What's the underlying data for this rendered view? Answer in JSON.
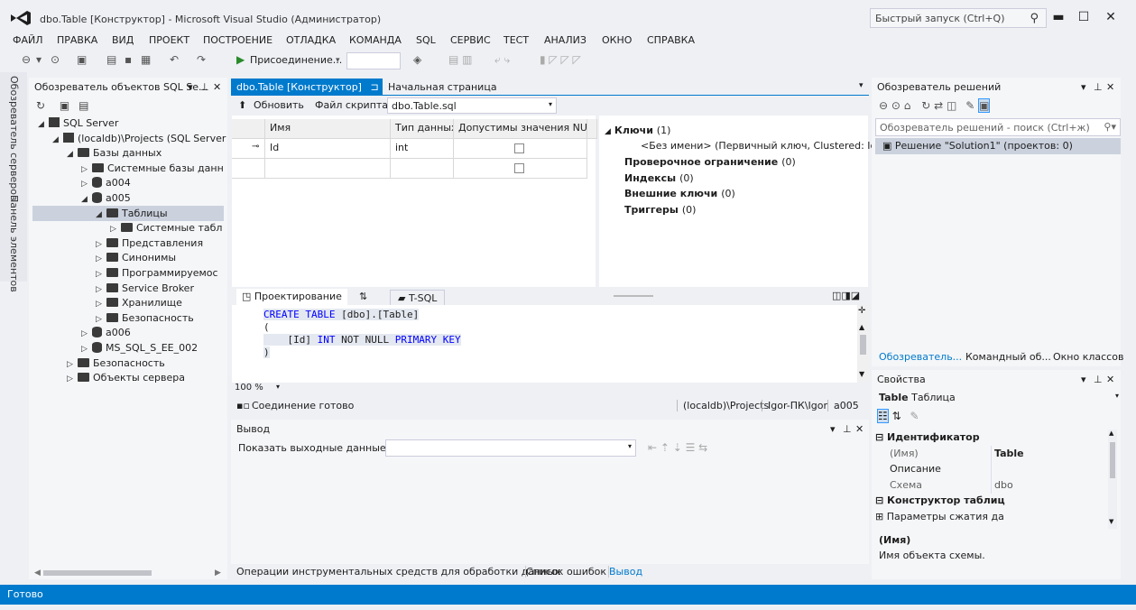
{
  "window": {
    "title": "dbo.Table [Конструктор] - Microsoft Visual Studio (Администратор)",
    "quick_launch_placeholder": "Быстрый запуск (Ctrl+Q)"
  },
  "menu": [
    "ФАЙЛ",
    "ПРАВКА",
    "ВИД",
    "ПРОЕКТ",
    "ПОСТРОЕНИЕ",
    "ОТЛАДКА",
    "КОМАНДА",
    "SQL",
    "СЕРВИС",
    "ТЕСТ",
    "АНАЛИЗ",
    "ОКНО",
    "СПРАВКА"
  ],
  "toolbar": {
    "attach_label": "Присоединение..."
  },
  "side_tabs": {
    "server_explorer": "Обозреватель серверов",
    "toolbox": "Панель элементов"
  },
  "object_explorer": {
    "title": "Обозреватель объектов SQL Se...",
    "tree": [
      {
        "label": "SQL Server",
        "level": 0,
        "arrow": "◢",
        "icon": "server-icon"
      },
      {
        "label": "(localdb)\\Projects (SQL Server",
        "level": 1,
        "arrow": "◢",
        "icon": "server-icon"
      },
      {
        "label": "Базы данных",
        "level": 2,
        "arrow": "◢",
        "icon": "folder-icon"
      },
      {
        "label": "Системные базы данн",
        "level": 3,
        "arrow": "▷",
        "icon": "folder-icon"
      },
      {
        "label": "a004",
        "level": 3,
        "arrow": "▷",
        "icon": "database-icon"
      },
      {
        "label": "a005",
        "level": 3,
        "arrow": "◢",
        "icon": "database-icon"
      },
      {
        "label": "Таблицы",
        "level": 4,
        "arrow": "◢",
        "icon": "folder-icon",
        "selected": true
      },
      {
        "label": "Системные табл",
        "level": 5,
        "arrow": "▷",
        "icon": "folder-icon"
      },
      {
        "label": "Представления",
        "level": 4,
        "arrow": "▷",
        "icon": "folder-icon"
      },
      {
        "label": "Синонимы",
        "level": 4,
        "arrow": "▷",
        "icon": "folder-icon"
      },
      {
        "label": "Программируемос",
        "level": 4,
        "arrow": "▷",
        "icon": "folder-icon"
      },
      {
        "label": "Service Broker",
        "level": 4,
        "arrow": "▷",
        "icon": "folder-icon"
      },
      {
        "label": "Хранилище",
        "level": 4,
        "arrow": "▷",
        "icon": "folder-icon"
      },
      {
        "label": "Безопасность",
        "level": 4,
        "arrow": "▷",
        "icon": "folder-icon"
      },
      {
        "label": "a006",
        "level": 3,
        "arrow": "▷",
        "icon": "database-icon"
      },
      {
        "label": "MS_SQL_S_EE_002",
        "level": 3,
        "arrow": "▷",
        "icon": "database-icon"
      },
      {
        "label": "Безопасность",
        "level": 2,
        "arrow": "▷",
        "icon": "folder-icon"
      },
      {
        "label": "Объекты сервера",
        "level": 2,
        "arrow": "▷",
        "icon": "folder-icon"
      }
    ]
  },
  "doc_tabs": {
    "active": "dbo.Table [Конструктор]",
    "active_pin": "⊐",
    "inactive": "Начальная страница"
  },
  "designer_toolbar": {
    "refresh": "Обновить",
    "script_file_label": "Файл скрипта:",
    "script_file_value": "dbo.Table.sql"
  },
  "grid": {
    "headers": [
      "Имя",
      "Тип данных",
      "Допустимы значения NULL"
    ],
    "rows": [
      {
        "name": "Id",
        "type": "int",
        "key": true
      }
    ]
  },
  "table_props": {
    "keys_label": "Ключи",
    "keys_count": "(1)",
    "key_entry": "<Без имени>   (Первичный ключ, Clustered: Id)",
    "items": [
      {
        "label": "Проверочное ограничение",
        "count": "(0)"
      },
      {
        "label": "Индексы",
        "count": "(0)"
      },
      {
        "label": "Внешние ключи",
        "count": "(0)"
      },
      {
        "label": "Триггеры",
        "count": "(0)"
      }
    ]
  },
  "pane_tabs": {
    "design": "Проектирование",
    "swap": "⇅",
    "tsql": "T-SQL"
  },
  "sql": {
    "l1_kw": "CREATE TABLE",
    "l1_rest": " [dbo].[Table]",
    "l2": "(",
    "l3_id": "    [Id] ",
    "l3_type": "INT",
    "l3_notnull": " NOT NULL ",
    "l3_pk": "PRIMARY KEY",
    "l4": ")"
  },
  "zoom": "100 %",
  "connection": {
    "status": "Соединение готово",
    "server": "(localdb)\\Projects",
    "user": "Igor-ПК\\Igor",
    "db": "a005"
  },
  "output": {
    "title": "Вывод",
    "show_from_label": "Показать выходные данные от:"
  },
  "bottom_tabs": [
    "Операции инструментальных средств для обработки данных",
    "Список ошибок",
    "Вывод"
  ],
  "status_bar": "Готово",
  "solution_explorer": {
    "title": "Обозреватель решений",
    "search_placeholder": "Обозреватель решений - поиск (Ctrl+ж)",
    "item": "Решение \"Solution1\"  (проектов: 0)",
    "tabs": [
      "Обозреватель...",
      "Командный об...",
      "Окно классов"
    ]
  },
  "properties": {
    "title": "Свойства",
    "object_type": "Table",
    "object_name": "Таблица",
    "categories": [
      {
        "label": "Идентификатор",
        "rows": [
          {
            "name": "(Имя)",
            "value": "Table"
          },
          {
            "name": "Описание",
            "value": ""
          },
          {
            "name": "Схема",
            "value": "dbo"
          }
        ]
      },
      {
        "label": "Конструктор таблиц",
        "rows": []
      }
    ],
    "collapsed_item": "Параметры сжатия да",
    "desc_title": "(Имя)",
    "desc_text": "Имя объекта схемы."
  },
  "colors": {
    "accent": "#007acc",
    "selected": "#cbd2de",
    "tab_active": "#007acc"
  }
}
